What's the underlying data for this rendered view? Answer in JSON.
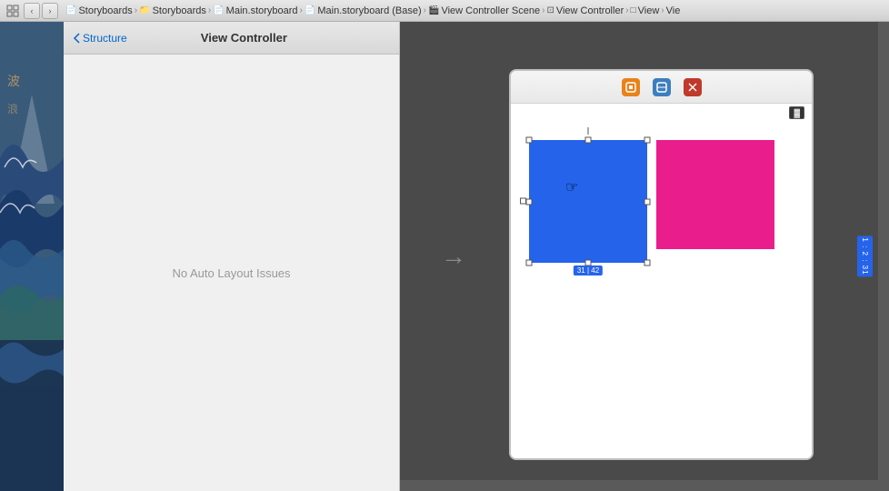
{
  "toolbar": {
    "grid_icon": "▦",
    "nav_back": "‹",
    "nav_forward": "›",
    "breadcrumbs": [
      {
        "label": "Storyboards",
        "icon": "📄"
      },
      {
        "label": "Storyboards",
        "icon": "📁"
      },
      {
        "label": "Main.storyboard",
        "icon": "📄"
      },
      {
        "label": "Main.storyboard (Base)",
        "icon": "📄"
      },
      {
        "label": "View Controller Scene",
        "icon": "🎬"
      },
      {
        "label": "View Controller",
        "icon": "⊡"
      },
      {
        "label": "View",
        "icon": "□"
      },
      {
        "label": "Vie",
        "icon": ""
      }
    ],
    "separator": "›"
  },
  "inspector": {
    "back_label": "Structure",
    "title": "View Controller",
    "no_issues": "No Auto Layout Issues"
  },
  "canvas": {
    "arrow": "→",
    "right_badge": "1 : 2 : 31"
  },
  "phone": {
    "toolbar_icons": [
      "orange",
      "blue",
      "red"
    ],
    "battery": "▓",
    "status_bar_right": "🔋",
    "blue_square_size": "31 | 42",
    "blue_square_bg": "#2563eb",
    "pink_square_bg": "#e91e8c"
  }
}
